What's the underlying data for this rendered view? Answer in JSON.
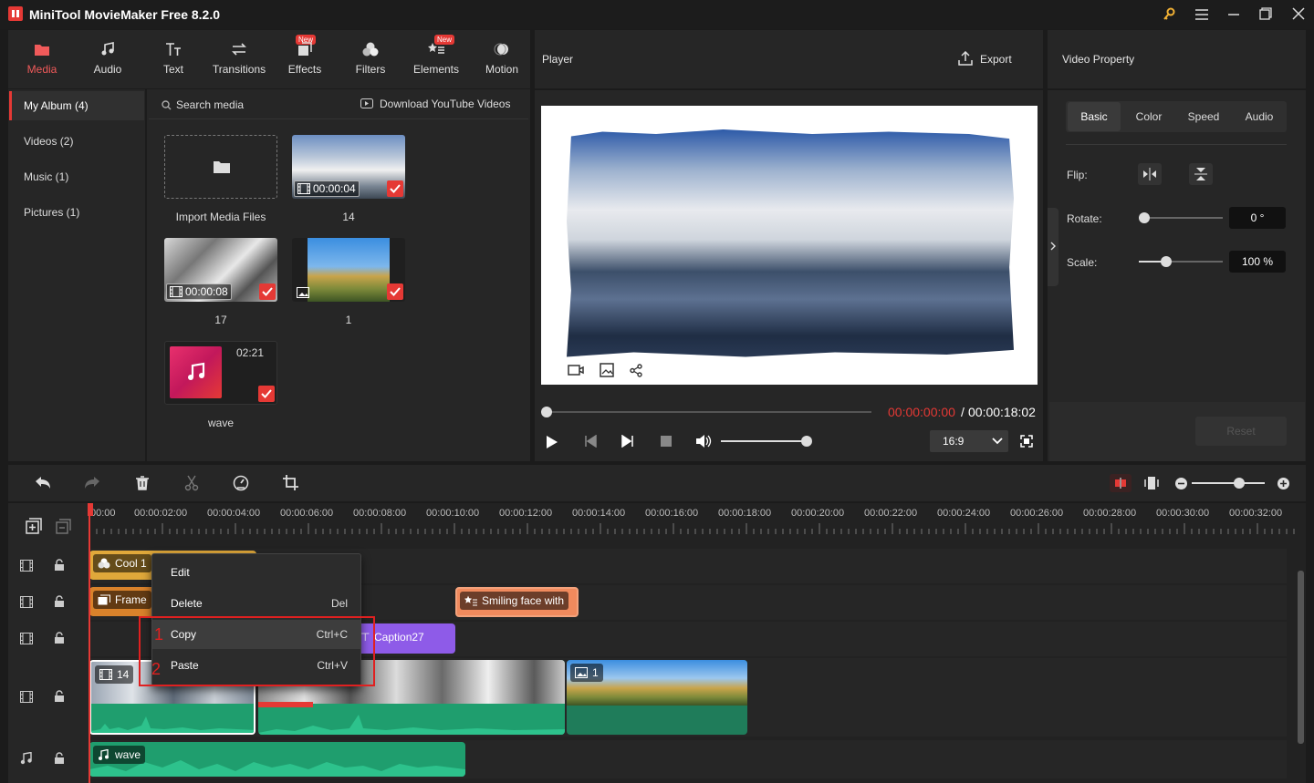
{
  "app": {
    "title": "MiniTool MovieMaker Free 8.2.0"
  },
  "top_tabs": [
    {
      "label": "Media",
      "icon": "media-icon",
      "active": true
    },
    {
      "label": "Audio",
      "icon": "audio-icon"
    },
    {
      "label": "Text",
      "icon": "text-icon"
    },
    {
      "label": "Transitions",
      "icon": "transitions-icon"
    },
    {
      "label": "Effects",
      "icon": "effects-icon",
      "badge": "New"
    },
    {
      "label": "Filters",
      "icon": "filters-icon"
    },
    {
      "label": "Elements",
      "icon": "elements-icon",
      "badge": "New"
    },
    {
      "label": "Motion",
      "icon": "motion-icon"
    }
  ],
  "sidebar": {
    "items": [
      {
        "label": "My Album (4)",
        "active": true
      },
      {
        "label": "Videos (2)"
      },
      {
        "label": "Music (1)"
      },
      {
        "label": "Pictures (1)"
      }
    ]
  },
  "media": {
    "search_placeholder": "Search media",
    "download_label": "Download YouTube Videos",
    "items": [
      {
        "caption": "Import Media Files"
      },
      {
        "caption": "14",
        "duration": "00:00:04"
      },
      {
        "caption": "17",
        "duration": "00:00:08"
      },
      {
        "caption": "1"
      },
      {
        "caption": "wave",
        "duration": "02:21"
      }
    ]
  },
  "player": {
    "title": "Player",
    "export_label": "Export",
    "time_current": "00:00:00:00",
    "time_separator": "/",
    "time_total": "00:00:18:02",
    "aspect_ratio": "16:9",
    "progress_fraction": 0.0,
    "volume_fraction": 1.0
  },
  "property": {
    "title": "Video Property",
    "tabs": [
      "Basic",
      "Color",
      "Speed",
      "Audio"
    ],
    "flip_label": "Flip:",
    "rotate_label": "Rotate:",
    "rotate_value": "0 °",
    "rotate_fraction": 0.0,
    "scale_label": "Scale:",
    "scale_value": "100 %",
    "scale_fraction": 0.3,
    "reset_label": "Reset"
  },
  "timeline": {
    "ticks": [
      "00:00",
      "00:00:02:00",
      "00:00:04:00",
      "00:00:06:00",
      "00:00:08:00",
      "00:00:10:00",
      "00:00:12:00",
      "00:00:14:00",
      "00:00:16:00",
      "00:00:18:00",
      "00:00:20:00",
      "00:00:22:00",
      "00:00:24:00",
      "00:00:26:00",
      "00:00:28:00",
      "00:00:30:00",
      "00:00:32:00"
    ],
    "zoom_fraction": 0.6,
    "clips": {
      "effect": "Cool 1",
      "element": "Frame",
      "text_element": "Smiling face with",
      "caption": "Caption27",
      "video1": "14",
      "video3": "1",
      "audio": "wave"
    }
  },
  "context_menu": {
    "items": [
      {
        "label": "Edit",
        "shortcut": ""
      },
      {
        "label": "Delete",
        "shortcut": "Del"
      },
      {
        "label": "Copy",
        "shortcut": "Ctrl+C",
        "marker": "1"
      },
      {
        "label": "Paste",
        "shortcut": "Ctrl+V",
        "marker": "2"
      }
    ]
  },
  "colors": {
    "accent": "#e53935",
    "audio_wave": "#1f9e6e",
    "caption_clip": "#8e5be8",
    "element_clip": "#f08a5d",
    "effect_clip": "#e0a83a"
  }
}
